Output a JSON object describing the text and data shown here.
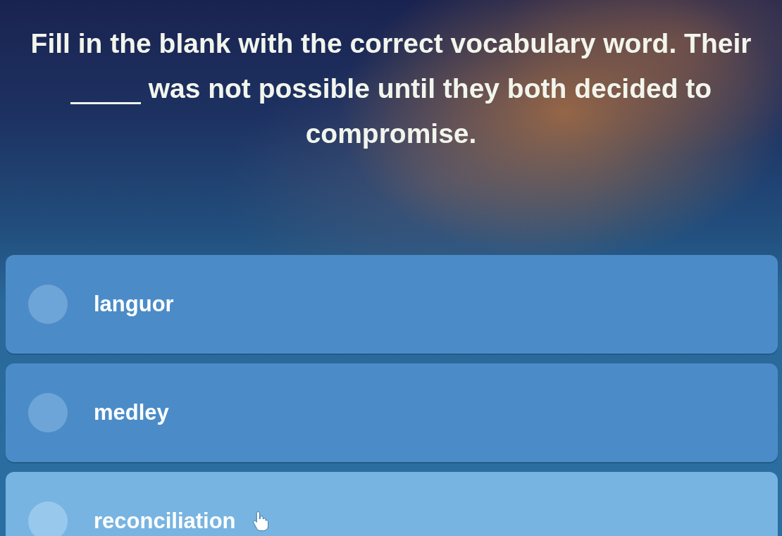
{
  "question": {
    "text_before": "Fill in the blank with the correct vocabulary word. Their",
    "text_after": "was not possible until they both decided to compromise."
  },
  "options": [
    {
      "label": "languor",
      "selected": false,
      "hovered": false
    },
    {
      "label": "medley",
      "selected": false,
      "hovered": false
    },
    {
      "label": "reconciliation",
      "selected": false,
      "hovered": true
    }
  ]
}
